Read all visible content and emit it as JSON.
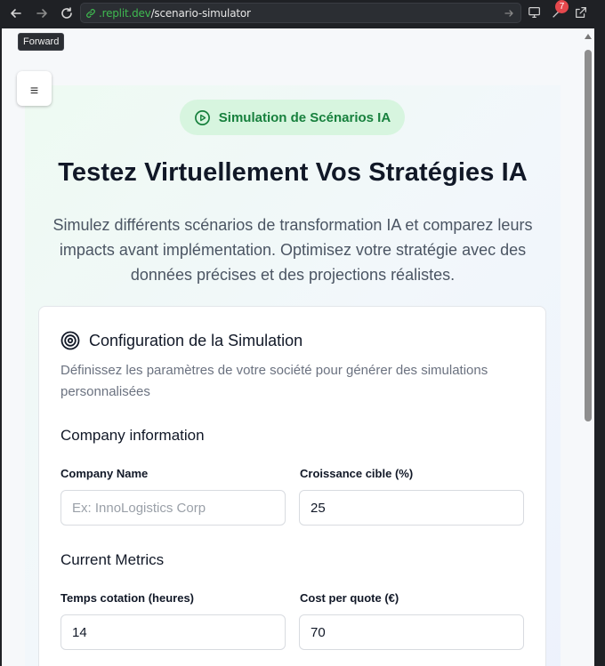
{
  "browser": {
    "url_host": ".replit.dev",
    "url_path": "/scenario-simulator",
    "tooltip": "Forward",
    "extensions_badge": "7"
  },
  "page": {
    "badge_label": "Simulation de Scénarios IA",
    "title": "Testez Virtuellement Vos Stratégies IA",
    "subtitle_lines": [
      "Simulez différents scénarios de transformation IA et comparez leurs",
      "impacts avant implémentation. Optimisez votre stratégie avec des",
      "données précises et des projections réalistes."
    ]
  },
  "config": {
    "title": "Configuration de la Simulation",
    "description_lines": [
      "Définissez les paramètres de votre société pour générer des simulations",
      "personnalisées"
    ],
    "company_section": "Company information",
    "company_name_label": "Company Name",
    "company_name_placeholder": "Ex: InnoLogistics Corp",
    "company_name_value": "",
    "growth_label": "Croissance cible (%)",
    "growth_value": "25",
    "metrics_section": "Current Metrics",
    "quote_time_label": "Temps cotation (heures)",
    "quote_time_value": "14",
    "cost_label": "Cost per quote (€)",
    "cost_value": "70"
  },
  "colors": {
    "accent_green": "#17803d",
    "pill_bg": "#d7f5df"
  }
}
